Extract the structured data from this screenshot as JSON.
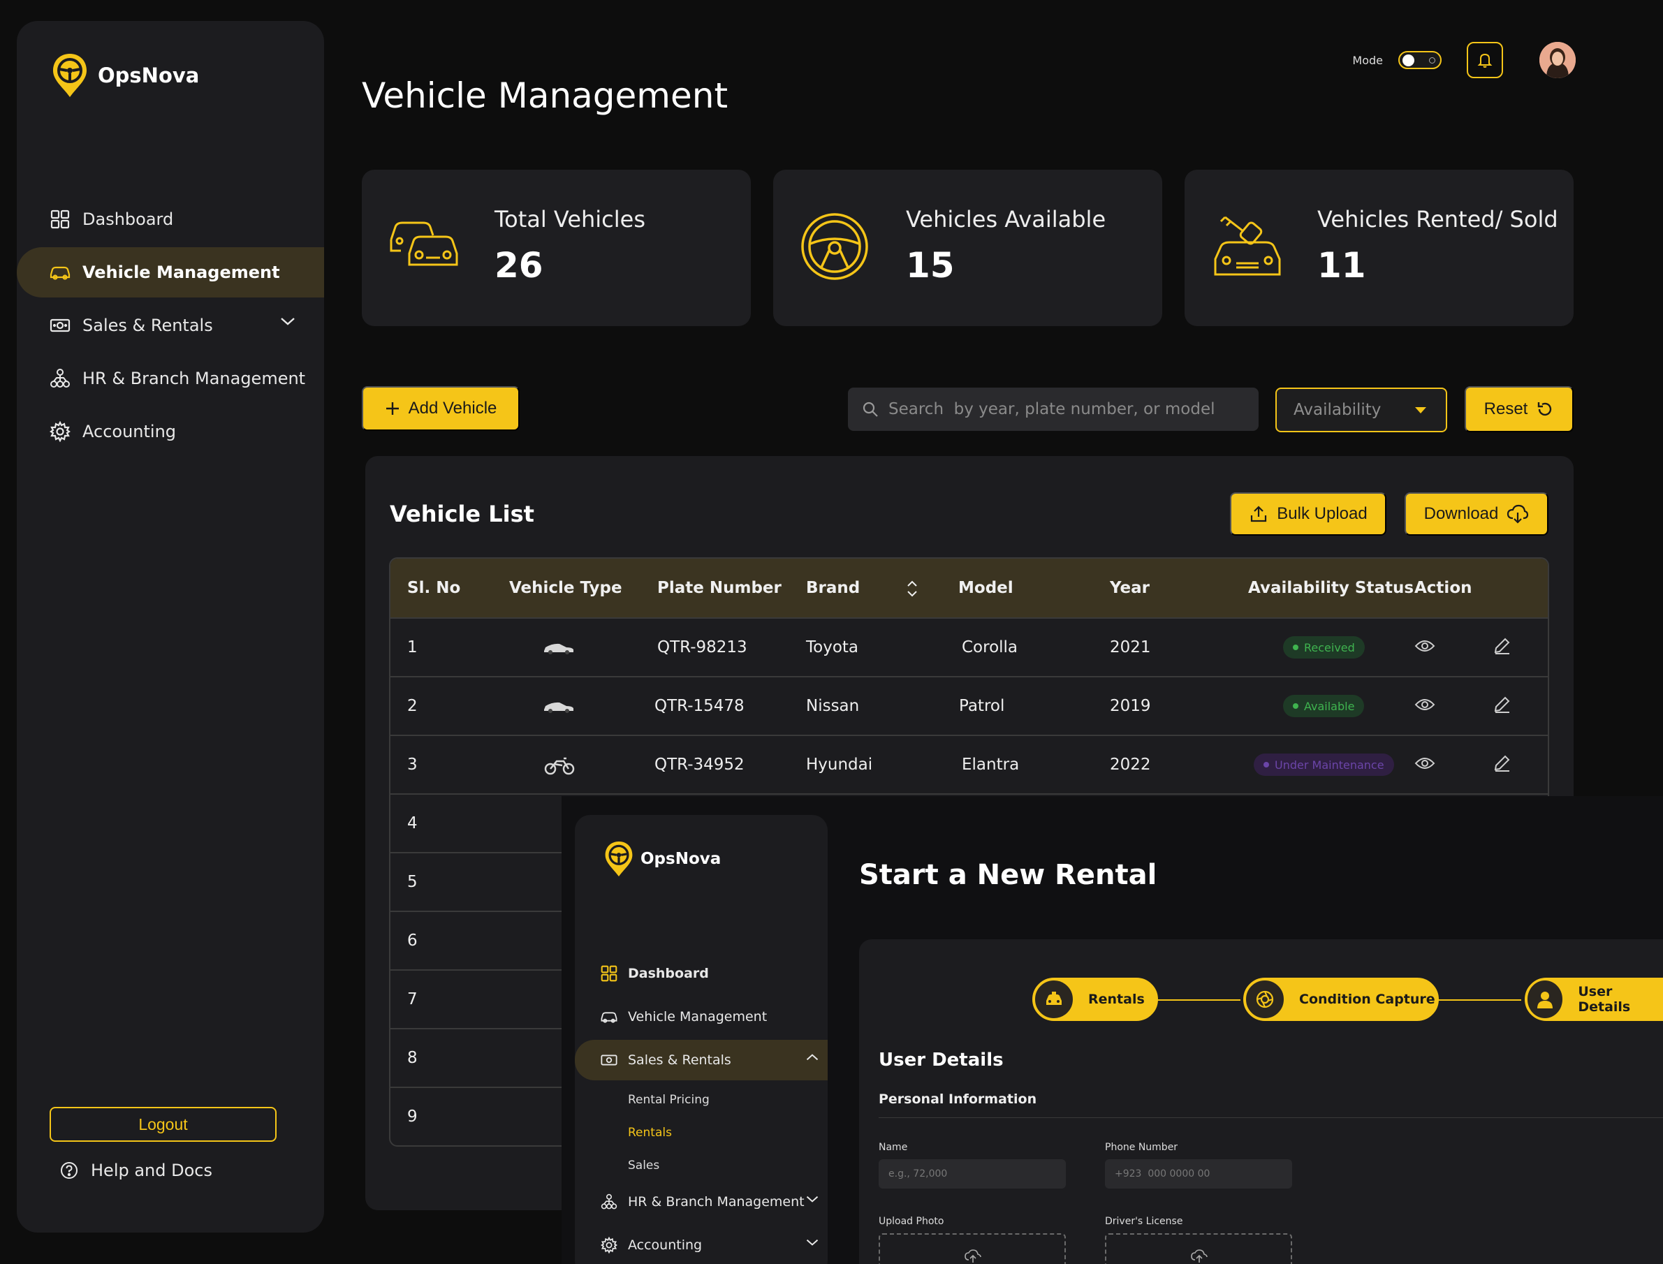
{
  "brand": {
    "name": "OpsNova",
    "accent": "#f5c518"
  },
  "sidebar": {
    "items": [
      {
        "label": "Dashboard",
        "icon": "grid-icon"
      },
      {
        "label": "Vehicle Management",
        "icon": "car-icon"
      },
      {
        "label": "Sales & Rentals",
        "icon": "cash-icon"
      },
      {
        "label": "HR & Branch Management",
        "icon": "org-chart-icon"
      },
      {
        "label": "Accounting",
        "icon": "gear-icon"
      }
    ],
    "logout": "Logout",
    "help": "Help and Docs"
  },
  "header": {
    "title": "Vehicle Management",
    "mode_label": "Mode"
  },
  "stats": [
    {
      "label": "Total Vehicles",
      "value": "26",
      "icon": "cars-icon"
    },
    {
      "label": "Vehicles Available",
      "value": "15",
      "icon": "steering-wheel-icon"
    },
    {
      "label": "Vehicles Rented/ Sold",
      "value": "11",
      "icon": "car-key-icon"
    }
  ],
  "toolbar": {
    "add_label": "Add Vehicle",
    "search_placeholder": "Search  by year, plate number, or model",
    "availability_placeholder": "Availability",
    "reset_label": "Reset"
  },
  "vehicle_list": {
    "title": "Vehicle List",
    "bulk_upload": "Bulk Upload",
    "download": "Download",
    "columns": [
      "Sl. No",
      "Vehicle Type",
      "Plate Number",
      "Brand",
      "Model",
      "Year",
      "Availability Status",
      "Action"
    ],
    "rows": [
      {
        "no": "1",
        "type": "car",
        "plate": "QTR-98213",
        "brand": "Toyota",
        "model": "Corolla",
        "year": "2021",
        "status": "Received",
        "status_color": "green"
      },
      {
        "no": "2",
        "type": "car",
        "plate": "QTR-15478",
        "brand": "Nissan",
        "model": "Patrol",
        "year": "2019",
        "status": "Available",
        "status_color": "green"
      },
      {
        "no": "3",
        "type": "motorbike",
        "plate": "QTR-34952",
        "brand": "Hyundai",
        "model": "Elantra",
        "year": "2022",
        "status": "Under Maintenance",
        "status_color": "purple"
      },
      {
        "no": "4"
      },
      {
        "no": "5"
      },
      {
        "no": "6"
      },
      {
        "no": "7"
      },
      {
        "no": "8"
      },
      {
        "no": "9"
      }
    ]
  },
  "rental": {
    "sidebar": {
      "items": [
        {
          "label": "Dashboard"
        },
        {
          "label": "Vehicle Management"
        },
        {
          "label": "Sales & Rentals"
        },
        {
          "label": "HR & Branch Management"
        },
        {
          "label": "Accounting"
        }
      ],
      "subitems": [
        "Rental Pricing",
        "Rentals",
        "Sales"
      ]
    },
    "title": "Start a New Rental",
    "steps": [
      "Rentals",
      "Condition Capture",
      "User Details"
    ],
    "section_title": "User Details",
    "personal_info": "Personal Information",
    "fields": {
      "name_label": "Name",
      "name_placeholder": "e.g., 72,000",
      "phone_label": "Phone Number",
      "phone_placeholder": "+923  000 0000 00",
      "photo_label": "Upload Photo",
      "license_label": "Driver's License"
    }
  }
}
